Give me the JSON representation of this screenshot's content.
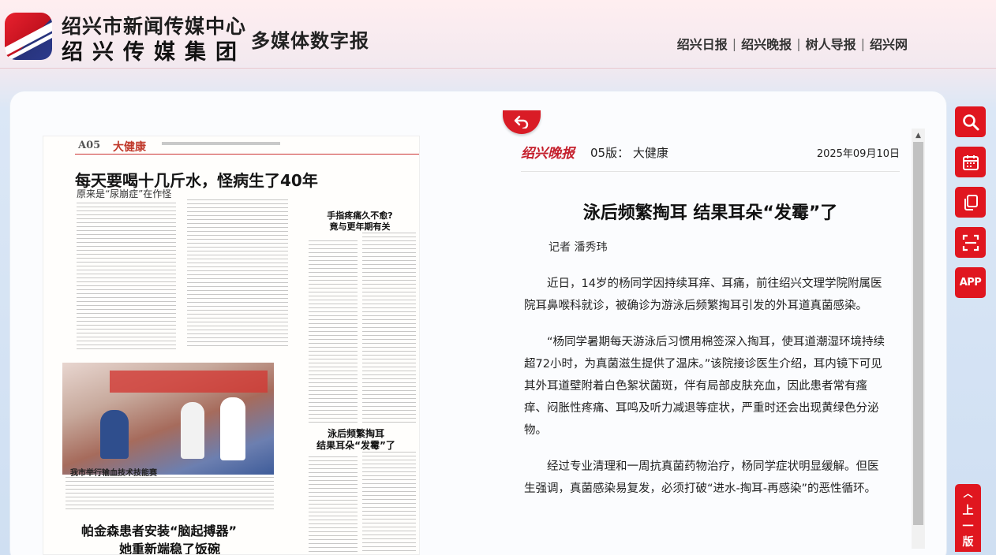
{
  "header": {
    "brand_cn": "绍兴市新闻传媒中心",
    "brand_script": "绍兴传媒集团",
    "brand_sub": "多媒体数字报",
    "nav": [
      "绍兴日报",
      "绍兴晚报",
      "树人导报",
      "绍兴网"
    ],
    "nav_separator": "|"
  },
  "newspaper_page": {
    "page_code": "A05",
    "section": "大健康",
    "headline": "每天要喝十几斤水，怪病生了40年",
    "subheadline": "原来是“尿崩症”在作怪",
    "side_headline": [
      "手指疼痛久不愈?",
      "竟与更年期有关"
    ],
    "story_headline": [
      "泳后频繁掏耳",
      "结果耳朵“发霉”了"
    ],
    "photo_caption": "我市举行输血技术技能赛",
    "bottom_headline": [
      "帕金森患者安装“脑起搏器”",
      "她重新端稳了饭碗"
    ]
  },
  "article": {
    "publication": "绍兴晚报",
    "edition": "05版： 大健康",
    "date": "2025年09月10日",
    "title": "泳后频繁掏耳 结果耳朵“发霉”了",
    "author": "记者 潘秀玮",
    "paragraphs": [
      "近日，14岁的杨同学因持续耳痒、耳痛，前往绍兴文理学院附属医院耳鼻喉科就诊，被确诊为游泳后频繁掏耳引发的外耳道真菌感染。",
      "“杨同学暑期每天游泳后习惯用棉签深入掏耳，使耳道潮湿环境持续超72小时，为真菌滋生提供了温床。”该院接诊医生介绍，耳内镜下可见其外耳道壁附着白色絮状菌斑，伴有局部皮肤充血，因此患者常有瘙痒、闷胀性疼痛、耳鸣及听力减退等症状，严重时还会出现黄绿色分泌物。",
      "经过专业清理和一周抗真菌药物治疗，杨同学症状明显缓解。但医生强调，真菌感染易复发，必须打破“进水-掏耳-再感染”的恶性循环。"
    ]
  },
  "tools": {
    "icons": [
      "search-icon",
      "calendar-icon",
      "copy-icon",
      "scan-icon",
      "app-icon"
    ],
    "app_label": "APP",
    "prev_page_label": "上一版",
    "accent": "#e0161f"
  }
}
